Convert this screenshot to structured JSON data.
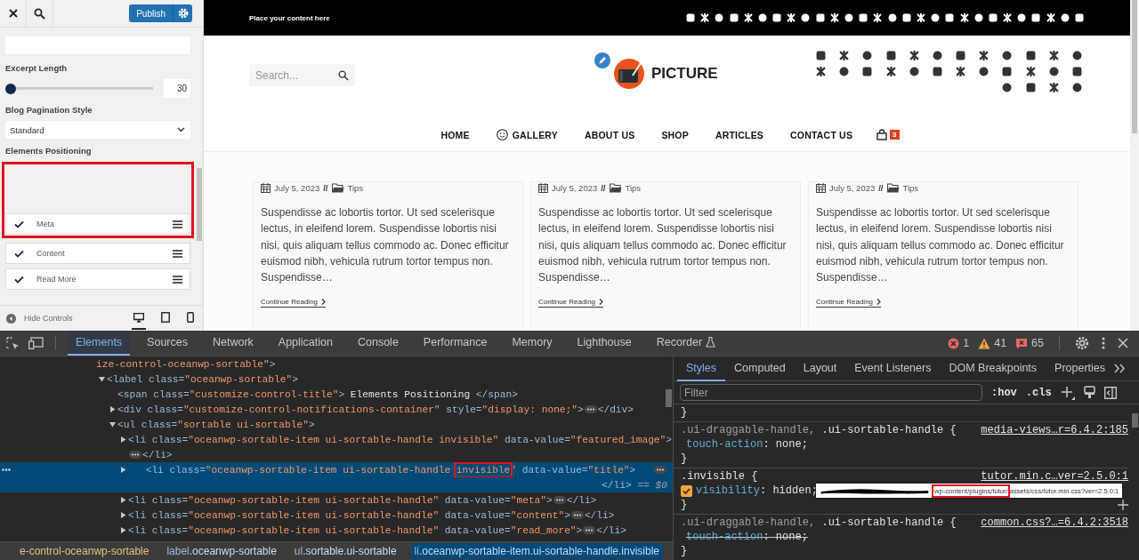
{
  "customizer": {
    "publish": "Publish",
    "fields": [
      {
        "kind": "input"
      },
      {
        "kind": "slider",
        "label": "Excerpt Length",
        "level": 0,
        "value": "30"
      },
      {
        "kind": "select",
        "label": "Blog Pagination Style",
        "value": "Standard"
      },
      {
        "kind": "sortable",
        "label": "Elements Positioning",
        "highlighted": true,
        "items": [
          {
            "label": "Meta",
            "checked": true,
            "highlighted": true
          },
          {
            "label": "Content",
            "checked": true,
            "highlighted": false
          },
          {
            "label": "Read More",
            "checked": true,
            "highlighted": false
          }
        ]
      }
    ],
    "hide_controls": "Hide Controls",
    "devices": [
      {
        "kind": "desktop",
        "selected": true
      },
      {
        "kind": "tablet",
        "selected": false
      },
      {
        "kind": "mobile",
        "selected": false
      }
    ]
  },
  "preview": {
    "topbar_text": "Place your content here",
    "search_placeholder": "Search...",
    "site_title": "PICTURE",
    "nav": [
      {
        "label": "HOME",
        "kind": "plain"
      },
      {
        "label": "GALLERY",
        "kind": "smiley"
      },
      {
        "label": "ABOUT US",
        "kind": "plain"
      },
      {
        "label": "SHOP",
        "kind": "plain"
      },
      {
        "label": "ARTICLES",
        "kind": "plain"
      },
      {
        "label": "CONTACT US",
        "kind": "plain"
      }
    ],
    "cart_count": "3",
    "posts": [
      {
        "date": "July 5, 2023",
        "separator": "//",
        "category": "Tips",
        "excerpt": "Suspendisse ac lobortis tortor. Ut sed scelerisque lectus, in eleifend lorem. Suspendisse lobortis nisi nisi, quis aliquam tellus commodo ac. Donec efficitur euismod nibh, vehicula rutrum tortor tempus non. Suspendisse…",
        "link": "Continue Reading"
      },
      {
        "date": "July 5, 2023",
        "separator": "//",
        "category": "Tips",
        "excerpt": "Suspendisse ac lobortis tortor. Ut sed scelerisque lectus, in eleifend lorem. Suspendisse lobortis nisi nisi, quis aliquam tellus commodo ac. Donec efficitur euismod nibh, vehicula rutrum tortor tempus non. Suspendisse…",
        "link": "Continue Reading"
      },
      {
        "date": "July 5, 2023",
        "separator": "//",
        "category": "Tips",
        "excerpt": "Suspendisse ac lobortis tortor. Ut sed scelerisque lectus, in eleifend lorem. Suspendisse lobortis nisi nisi, quis aliquam tellus commodo ac. Donec efficitur euismod nibh, vehicula rutrum tortor tempus non. Suspendisse…",
        "link": "Continue Reading"
      }
    ]
  },
  "devtools": {
    "tabs": [
      {
        "label": "Elements",
        "selected": true,
        "kind": "plain"
      },
      {
        "label": "Sources",
        "selected": false,
        "kind": "plain"
      },
      {
        "label": "Network",
        "selected": false,
        "kind": "plain"
      },
      {
        "label": "Application",
        "selected": false,
        "kind": "plain"
      },
      {
        "label": "Console",
        "selected": false,
        "kind": "plain"
      },
      {
        "label": "Performance",
        "selected": false,
        "kind": "plain"
      },
      {
        "label": "Memory",
        "selected": false,
        "kind": "plain"
      },
      {
        "label": "Lighthouse",
        "selected": false,
        "kind": "plain"
      },
      {
        "label": "Recorder",
        "selected": false,
        "kind": "flask"
      }
    ],
    "errors": "1",
    "warnings": "41",
    "issues": "65",
    "dom": [
      {
        "selected": false,
        "lines": [
          [
            {
              "kind": "val",
              "t": "ize-control-oceanwp-sortable\""
            },
            {
              "kind": "tag",
              "t": ">"
            }
          ]
        ],
        "children": [
          {
            "expanded": true,
            "selected": false,
            "lines": [
              [
                {
                  "kind": "tag",
                  "t": "<label"
                },
                {
                  "kind": "attr",
                  "t": " class"
                },
                {
                  "kind": "tag",
                  "t": "="
                },
                {
                  "kind": "val",
                  "t": "\"oceanwp-sortable\""
                },
                {
                  "kind": "tag",
                  "t": ">"
                }
              ]
            ],
            "children": [
              {
                "selected": false,
                "lines": [
                  [
                    {
                      "kind": "tag",
                      "t": "<span"
                    },
                    {
                      "kind": "attr",
                      "t": " class"
                    },
                    {
                      "kind": "tag",
                      "t": "="
                    },
                    {
                      "kind": "val",
                      "t": "\"customize-control-title\""
                    },
                    {
                      "kind": "tag",
                      "t": ">"
                    },
                    {
                      "kind": "text",
                      "t": " Elements Positioning "
                    },
                    {
                      "kind": "tag",
                      "t": "</span>"
                    }
                  ]
                ]
              },
              {
                "expanded": false,
                "selected": false,
                "lines": [
                  [
                    {
                      "kind": "tag",
                      "t": "<div"
                    },
                    {
                      "kind": "attr",
                      "t": " class"
                    },
                    {
                      "kind": "tag",
                      "t": "="
                    },
                    {
                      "kind": "val",
                      "t": "\"customize-control-notifications-container\""
                    },
                    {
                      "kind": "attr",
                      "t": " style"
                    },
                    {
                      "kind": "tag",
                      "t": "="
                    },
                    {
                      "kind": "val",
                      "t": "\"display: none;\""
                    },
                    {
                      "kind": "tag",
                      "t": ">"
                    },
                    {
                      "kind": "more"
                    },
                    {
                      "kind": "tag",
                      "t": "</div>"
                    }
                  ]
                ]
              },
              {
                "expanded": true,
                "selected": false,
                "lines": [
                  [
                    {
                      "kind": "tag",
                      "t": "<ul"
                    },
                    {
                      "kind": "attr",
                      "t": " class"
                    },
                    {
                      "kind": "tag",
                      "t": "="
                    },
                    {
                      "kind": "val",
                      "t": "\"sortable ui-sortable\""
                    },
                    {
                      "kind": "tag",
                      "t": ">"
                    }
                  ]
                ],
                "children": [
                  {
                    "expanded": false,
                    "selected": false,
                    "lines": [
                      [
                        {
                          "kind": "tag",
                          "t": "<li"
                        },
                        {
                          "kind": "attr",
                          "t": " class"
                        },
                        {
                          "kind": "tag",
                          "t": "="
                        },
                        {
                          "kind": "val",
                          "t": "\"oceanwp-sortable-item ui-sortable-handle invisible\""
                        },
                        {
                          "kind": "attr",
                          "t": " data-value"
                        },
                        {
                          "kind": "tag",
                          "t": "="
                        },
                        {
                          "kind": "val",
                          "t": "\"featured_image\""
                        },
                        {
                          "kind": "tag",
                          "t": ">"
                        }
                      ],
                      [
                        {
                          "kind": "more"
                        },
                        {
                          "kind": "tag",
                          "t": "</li>"
                        }
                      ]
                    ]
                  },
                  {
                    "expanded": false,
                    "selected": true,
                    "lines": [
                      [
                        {
                          "kind": "tag",
                          "t": "<li"
                        },
                        {
                          "kind": "attr",
                          "t": " class"
                        },
                        {
                          "kind": "tag",
                          "t": "="
                        },
                        {
                          "kind": "val",
                          "t": "\"oceanwp-sortable-item ui-sortable-handle "
                        },
                        {
                          "kind": "val",
                          "t": "invisible",
                          "boxed": true
                        },
                        {
                          "kind": "val",
                          "t": "\""
                        },
                        {
                          "kind": "attr",
                          "t": " data-value"
                        },
                        {
                          "kind": "tag",
                          "t": "="
                        },
                        {
                          "kind": "val",
                          "t": "\"title\""
                        },
                        {
                          "kind": "tag",
                          "t": ">"
                        },
                        {
                          "kind": "more"
                        }
                      ],
                      [
                        {
                          "kind": "tag",
                          "t": "</li>"
                        },
                        {
                          "kind": "hint",
                          "t": " == $0"
                        }
                      ]
                    ]
                  },
                  {
                    "expanded": false,
                    "selected": false,
                    "lines": [
                      [
                        {
                          "kind": "tag",
                          "t": "<li"
                        },
                        {
                          "kind": "attr",
                          "t": " class"
                        },
                        {
                          "kind": "tag",
                          "t": "="
                        },
                        {
                          "kind": "val",
                          "t": "\"oceanwp-sortable-item ui-sortable-handle\""
                        },
                        {
                          "kind": "attr",
                          "t": " data-value"
                        },
                        {
                          "kind": "tag",
                          "t": "="
                        },
                        {
                          "kind": "val",
                          "t": "\"meta\""
                        },
                        {
                          "kind": "tag",
                          "t": ">"
                        },
                        {
                          "kind": "more"
                        },
                        {
                          "kind": "tag",
                          "t": "</li>"
                        }
                      ]
                    ]
                  },
                  {
                    "expanded": false,
                    "selected": false,
                    "lines": [
                      [
                        {
                          "kind": "tag",
                          "t": "<li"
                        },
                        {
                          "kind": "attr",
                          "t": " class"
                        },
                        {
                          "kind": "tag",
                          "t": "="
                        },
                        {
                          "kind": "val",
                          "t": "\"oceanwp-sortable-item ui-sortable-handle\""
                        },
                        {
                          "kind": "attr",
                          "t": " data-value"
                        },
                        {
                          "kind": "tag",
                          "t": "="
                        },
                        {
                          "kind": "val",
                          "t": "\"content\""
                        },
                        {
                          "kind": "tag",
                          "t": ">"
                        },
                        {
                          "kind": "more"
                        },
                        {
                          "kind": "tag",
                          "t": "</li>"
                        }
                      ]
                    ]
                  },
                  {
                    "expanded": false,
                    "selected": false,
                    "lines": [
                      [
                        {
                          "kind": "tag",
                          "t": "<li"
                        },
                        {
                          "kind": "attr",
                          "t": " class"
                        },
                        {
                          "kind": "tag",
                          "t": "="
                        },
                        {
                          "kind": "val",
                          "t": "\"oceanwp-sortable-item ui-sortable-handle\""
                        },
                        {
                          "kind": "attr",
                          "t": " data-value"
                        },
                        {
                          "kind": "tag",
                          "t": "="
                        },
                        {
                          "kind": "val",
                          "t": "\"read_more\""
                        },
                        {
                          "kind": "tag",
                          "t": ">"
                        },
                        {
                          "kind": "more"
                        },
                        {
                          "kind": "tag",
                          "t": "</li>"
                        }
                      ]
                    ]
                  }
                ]
              }
            ]
          }
        ]
      }
    ],
    "breadcrumbs": [
      {
        "selected": false,
        "parts": [
          {
            "kind": "cut",
            "t": "e-control-oceanwp-sortable"
          }
        ]
      },
      {
        "selected": false,
        "parts": [
          {
            "kind": "tag",
            "t": "label"
          },
          {
            "kind": "cls",
            "t": ".oceanwp-sortable"
          }
        ]
      },
      {
        "selected": false,
        "parts": [
          {
            "kind": "tag",
            "t": "ul"
          },
          {
            "kind": "cls",
            "t": ".sortable.ui-sortable"
          }
        ]
      },
      {
        "selected": true,
        "parts": [
          {
            "kind": "tag",
            "t": "li"
          },
          {
            "kind": "cls",
            "t": ".oceanwp-sortable-item.ui-sortable-handle.invisible"
          }
        ]
      }
    ],
    "style_tabs": [
      {
        "label": "Styles",
        "selected": true
      },
      {
        "label": "Computed",
        "selected": false
      },
      {
        "label": "Layout",
        "selected": false
      },
      {
        "label": "Event Listeners",
        "selected": false
      },
      {
        "label": "DOM Breakpoints",
        "selected": false
      },
      {
        "label": "Properties",
        "selected": false
      }
    ],
    "filter_placeholder": "Filter",
    "hov": ":hov",
    "cls": ".cls",
    "rules": [
      {
        "close": "}"
      },
      {
        "selector": [
          {
            "t": ".ui-draggable-handle, ",
            "matched": false
          },
          {
            "t": ".ui-sortable-handle {",
            "matched": true
          }
        ],
        "source": "media-views…r=6.4.2:185",
        "declarations": [
          {
            "prop": "touch-action",
            "value": ": none;",
            "overridden": false
          }
        ],
        "close": "}"
      },
      {
        "selector": [
          {
            "t": ".invisible {",
            "matched": true
          }
        ],
        "source": "tutor.min.c…ver=2.5.0:1",
        "declarations": [
          {
            "prop": "visibility",
            "value": ": hidden;",
            "overridden": false,
            "checked": true
          }
        ],
        "close": "}",
        "add_button": true,
        "tooltip": {
          "redacted": true,
          "parts": [
            {
              "t": "wp-content/plugins/tutor/",
              "boxed": true
            },
            {
              "t": "assets/css/tutor.min.css?ver=2.5.0:1",
              "boxed": false
            }
          ]
        }
      },
      {
        "selector": [
          {
            "t": ".ui-draggable-handle, ",
            "matched": false
          },
          {
            "t": ".ui-sortable-handle {",
            "matched": true
          }
        ],
        "source": "common.css?…=6.4.2:3518",
        "declarations": [
          {
            "prop": "touch-action",
            "value": ": none;",
            "overridden": true
          }
        ],
        "close": "}"
      }
    ]
  }
}
